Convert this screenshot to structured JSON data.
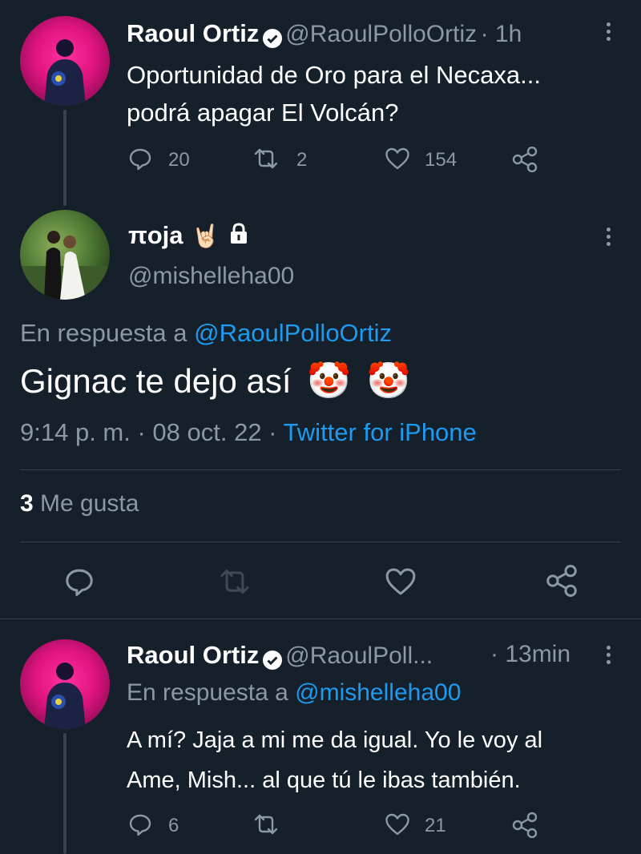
{
  "tweet1": {
    "name": "Raoul Ortiz",
    "handle": "@RaoulPolloOrtiz",
    "time": "· 1h",
    "text_line1": "Oportunidad de Oro para el Necaxa...",
    "text_line2": "podrá apagar El Volcán?",
    "replies": "20",
    "retweets": "2",
    "likes": "154"
  },
  "main": {
    "name": "πoja",
    "name_emoji": "🤘🏻",
    "handle": "@mishelleha00",
    "reply_prefix": "En respuesta a",
    "reply_to": "@RaoulPolloOrtiz",
    "text": "Gignac te dejo así",
    "emoji1": "🤡",
    "emoji2": "🤡",
    "timestamp": "9:14 p. m. · 08 oct. 22 ·",
    "source": "Twitter for iPhone",
    "likes_count": "3",
    "likes_label": "Me gusta"
  },
  "tweet2": {
    "name": "Raoul Ortiz",
    "handle": "@RaoulPoll...",
    "time": "· 13min",
    "reply_prefix": "En respuesta a",
    "reply_to": "@mishelleha00",
    "text_line1": "A mí? Jaja a mi me da igual. Yo le voy al",
    "text_line2": "Ame, Mish... al que tú le ibas también.",
    "replies": "6",
    "likes": "21"
  },
  "colors": {
    "background": "#15202b",
    "muted": "#8b98a5",
    "link": "#1d9bf0",
    "divider": "#38444d"
  }
}
